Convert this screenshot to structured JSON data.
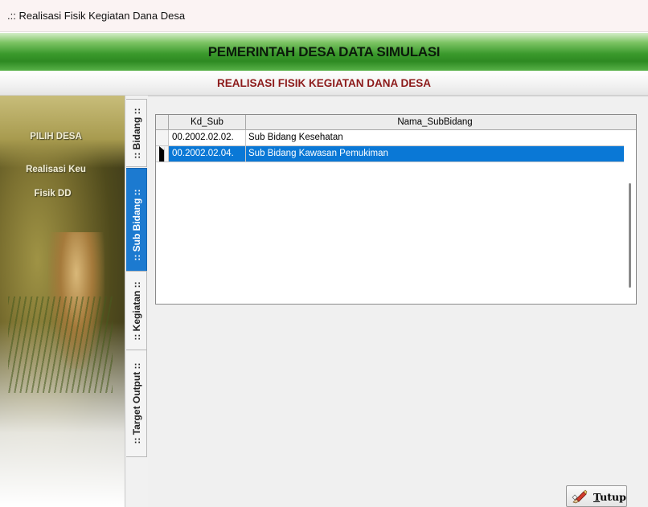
{
  "window": {
    "title": ".:: Realisasi Fisik Kegiatan Dana Desa"
  },
  "header": {
    "title": "PEMERINTAH DESA DATA SIMULASI",
    "subtitle": "REALISASI FISIK KEGIATAN DANA DESA"
  },
  "sidebar": {
    "items": [
      {
        "label": "PILIH DESA"
      },
      {
        "label": "Realisasi Keu"
      },
      {
        "label": "Fisik DD"
      }
    ]
  },
  "tabs": [
    {
      "label": ":: Bidang ::",
      "active": false
    },
    {
      "label": ":: Sub Bidang ::",
      "active": true
    },
    {
      "label": ":: Kegiatan ::",
      "active": false
    },
    {
      "label": ":: Target Output ::",
      "active": false
    }
  ],
  "grid": {
    "columns": [
      "Kd_Sub",
      "Nama_SubBidang"
    ],
    "rows": [
      {
        "kd_sub": "00.2002.02.02.",
        "nama": "Sub Bidang Kesehatan",
        "selected": false
      },
      {
        "kd_sub": "00.2002.02.04.",
        "nama": "Sub Bidang Kawasan Pemukiman",
        "selected": true
      }
    ]
  },
  "buttons": {
    "close": {
      "label_first": "T",
      "label_rest": "utup",
      "icon": "pencil-eraser-icon"
    }
  },
  "colors": {
    "header_green": "#3b9a2c",
    "subtitle_red": "#8c1a1a",
    "selection_blue": "#0a78d6",
    "active_tab_blue": "#1c7ad0"
  }
}
